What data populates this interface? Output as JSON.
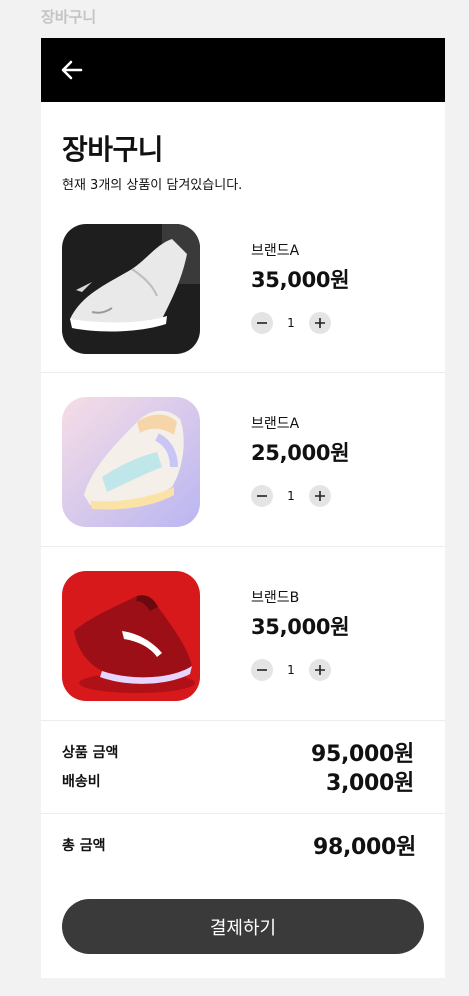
{
  "frame_label": "장바구니",
  "header": {
    "back_icon": "arrow-left-icon"
  },
  "page": {
    "title": "장바구니",
    "subtitle": "현재 3개의 상품이 담겨있습니다."
  },
  "items": [
    {
      "brand": "브랜드A",
      "price": "35,000원",
      "qty": "1"
    },
    {
      "brand": "브랜드A",
      "price": "25,000원",
      "qty": "1"
    },
    {
      "brand": "브랜드B",
      "price": "35,000원",
      "qty": "1"
    }
  ],
  "summary": {
    "subtotal_label": "상품 금액",
    "subtotal_value": "95,000원",
    "shipping_label": "배송비",
    "shipping_value": "3,000원"
  },
  "total": {
    "label": "총 금액",
    "value": "98,000원"
  },
  "checkout_label": "결제하기",
  "colors": {
    "topbar": "#000000",
    "checkout_button": "#3a3a3a",
    "stepper_button": "#e4e4e4"
  }
}
